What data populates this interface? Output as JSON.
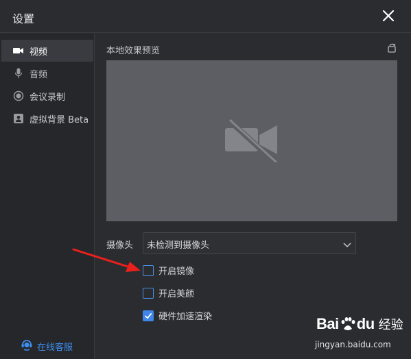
{
  "window": {
    "title": "设置"
  },
  "sidebar": {
    "items": [
      {
        "label": "视频",
        "icon": "video-camera-icon",
        "active": true
      },
      {
        "label": "音频",
        "icon": "microphone-icon",
        "active": false
      },
      {
        "label": "会议录制",
        "icon": "record-icon",
        "active": false
      },
      {
        "label": "虚拟背景 Beta",
        "icon": "portrait-icon",
        "active": false
      }
    ],
    "service_label": "在线客服",
    "service_icon": "customer-service-icon"
  },
  "main": {
    "preview_title": "本地效果预览",
    "rotate_icon": "rotate-icon",
    "preview_icon": "camera-off-icon",
    "camera_label": "摄像头",
    "camera_select_value": "未检测到摄像头",
    "options": [
      {
        "label": "开启镜像",
        "checked": false
      },
      {
        "label": "开启美颜",
        "checked": false
      },
      {
        "label": "硬件加速渲染",
        "checked": true
      }
    ]
  },
  "colors": {
    "accent": "#3f86e8",
    "annotation_arrow": "#e8211d",
    "preview_bg": "#5d5e63"
  },
  "watermark": {
    "brand": "Bai",
    "brand_suffix": "du",
    "cn": "经验",
    "url": "jingyan.baidu.com"
  }
}
